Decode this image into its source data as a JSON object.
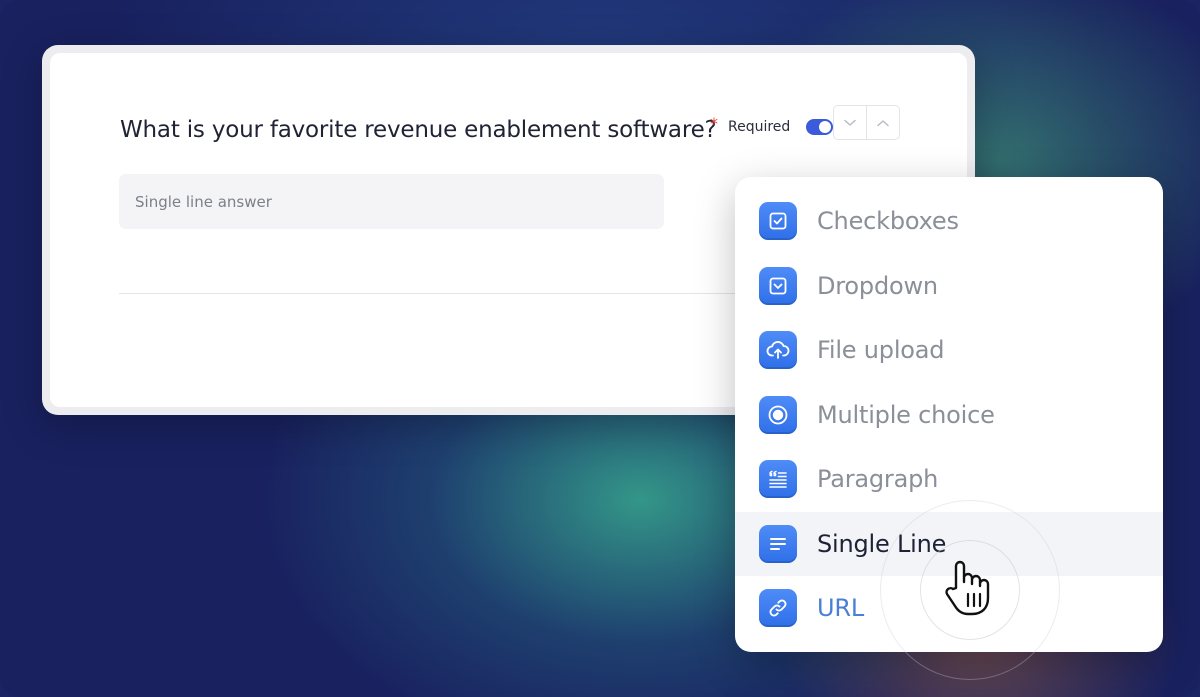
{
  "question": {
    "title": "What is your favorite revenue enablement software?",
    "required_star": "*",
    "required_label": "Required",
    "required_on": true,
    "answer_placeholder": "Single line answer"
  },
  "menu": {
    "items": [
      {
        "label": "Checkboxes",
        "icon": "checkbox-icon"
      },
      {
        "label": "Dropdown",
        "icon": "dropdown-icon"
      },
      {
        "label": "File upload",
        "icon": "cloud-upload-icon"
      },
      {
        "label": "Multiple choice",
        "icon": "radio-icon"
      },
      {
        "label": "Paragraph",
        "icon": "paragraph-icon"
      },
      {
        "label": "Single Line",
        "icon": "single-line-icon",
        "active": true
      },
      {
        "label": "URL",
        "icon": "link-icon"
      }
    ]
  },
  "colors": {
    "accent": "#3b5bdb",
    "icon_blue": "#3a7bf0",
    "required_star": "#e0473e"
  }
}
